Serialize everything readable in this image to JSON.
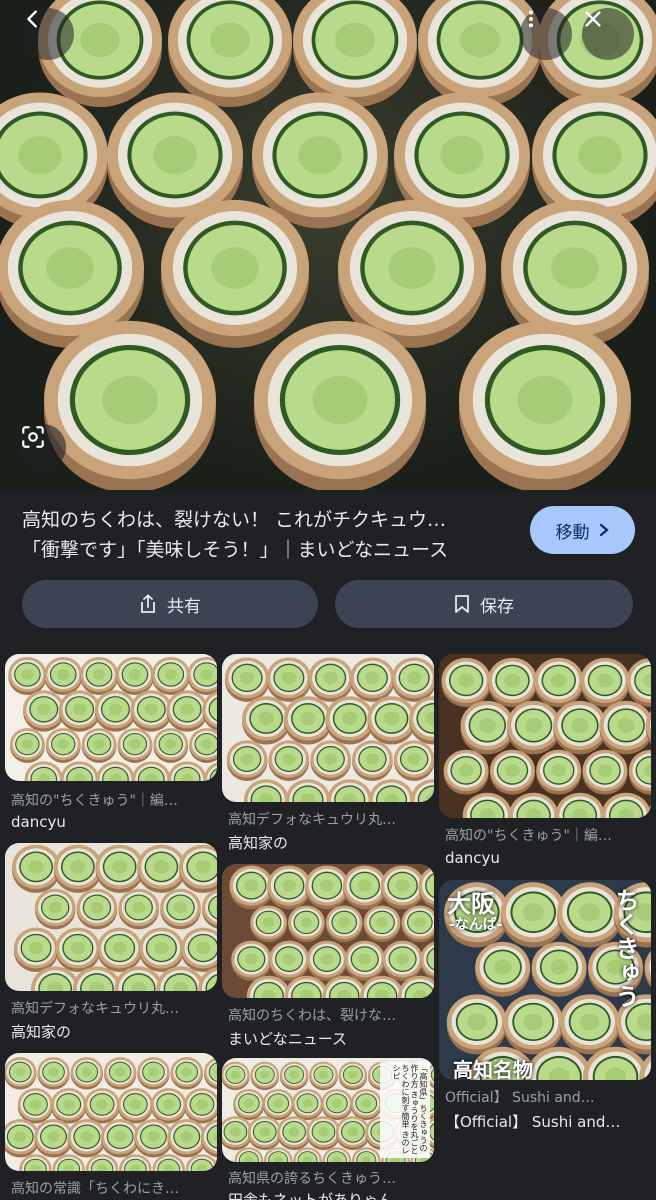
{
  "hero": {
    "title_line1": "高知のちくわは、裂けない！ これがチクキュウ…",
    "title_line2": "「衝撃です」「美味しそう！」｜まいどなニュース",
    "visit_label": "移動",
    "share_label": "共有",
    "save_label": "保存",
    "icons": [
      "back-arrow-icon",
      "more-vert-icon",
      "close-icon",
      "lens-icon",
      "share-icon",
      "bookmark-icon",
      "chevron-right-icon"
    ]
  },
  "results": [
    {
      "title": "高知の\"ちくきゅう\"｜編…",
      "source": "dancyu"
    },
    {
      "title": "高知デフォなキュウリ丸…",
      "source": "高知家の"
    },
    {
      "title": "高知の\"ちくきゅう\"｜編…",
      "source": "dancyu"
    },
    {
      "title": "高知デフォなキュウリ丸…",
      "source": "高知家の"
    },
    {
      "title": "高知のちくわは、裂けな…",
      "source": "まいどなニュース"
    },
    {
      "title": "Official】 Sushi and…",
      "source": "【Official】 Sushi and…",
      "overlay": {
        "city": "大阪",
        "area": "-なんば-",
        "vertical": "ちくきゅう",
        "bottom": "高知名物"
      }
    },
    {
      "title": "高知の常識「ちくわにき…",
      "source": ""
    },
    {
      "title": "高知県の誇るちくきゅう…",
      "source": "田舎もネットがありゃん…",
      "overlay": {
        "vertical_text": "「高知県」ちくきゅうの作り方 きゅうりを丸ごとちくわに刺す簡単 きのレシピ"
      }
    }
  ],
  "colors": {
    "background": "#202124",
    "accent": "#a8c7fa",
    "pill": "#3c4454",
    "cucumber": "#b9d98b",
    "chikuwa": "#c9a37a"
  }
}
